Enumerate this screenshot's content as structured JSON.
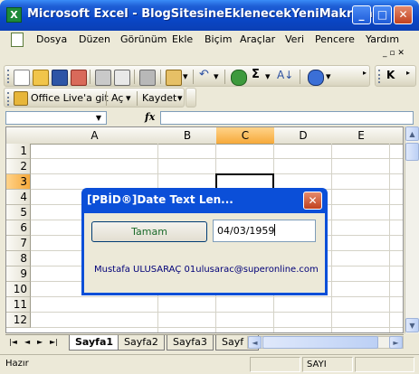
{
  "window": {
    "title": "Microsoft Excel - BlogSitesineEklenecekYeniMakrolar",
    "buttons": {
      "minimize": "_",
      "maximize": "□",
      "close": "✕"
    }
  },
  "menu": {
    "items": [
      "Dosya",
      "Düzen",
      "Görünüm",
      "Ekle",
      "Biçim",
      "Araçlar",
      "Veri",
      "Pencere",
      "Yardım"
    ]
  },
  "toolbar3": {
    "office_live": "Office Live'a git",
    "open": "Aç",
    "save": "Kaydet"
  },
  "formula_bar": {
    "fx": "fx"
  },
  "grid": {
    "columns": [
      "A",
      "B",
      "C",
      "D",
      "E"
    ],
    "selected_column": "C",
    "rows": [
      "1",
      "2",
      "3",
      "4",
      "5",
      "6",
      "7",
      "8",
      "9",
      "10",
      "11",
      "12"
    ],
    "selected_row": "3"
  },
  "sheets": {
    "tabs": [
      "Sayfa1",
      "Sayfa2",
      "Sayfa3",
      "Sayf"
    ],
    "active": "Sayfa1",
    "nav": [
      "|◄",
      "◄",
      "►",
      "►|"
    ]
  },
  "status": {
    "left": "Hazır",
    "mode": "SAYI"
  },
  "dialog": {
    "title": "[PBİD®]Date Text Len...",
    "ok_button": "Tamam",
    "date_value": "04/03/1959",
    "message": "Mustafa ULUSARAÇ 01ulusarac@superonline.com"
  },
  "colors": {
    "xp_blue": "#0b4fd8",
    "selected_header": "#f6a93a",
    "close_red": "#c1411f"
  }
}
